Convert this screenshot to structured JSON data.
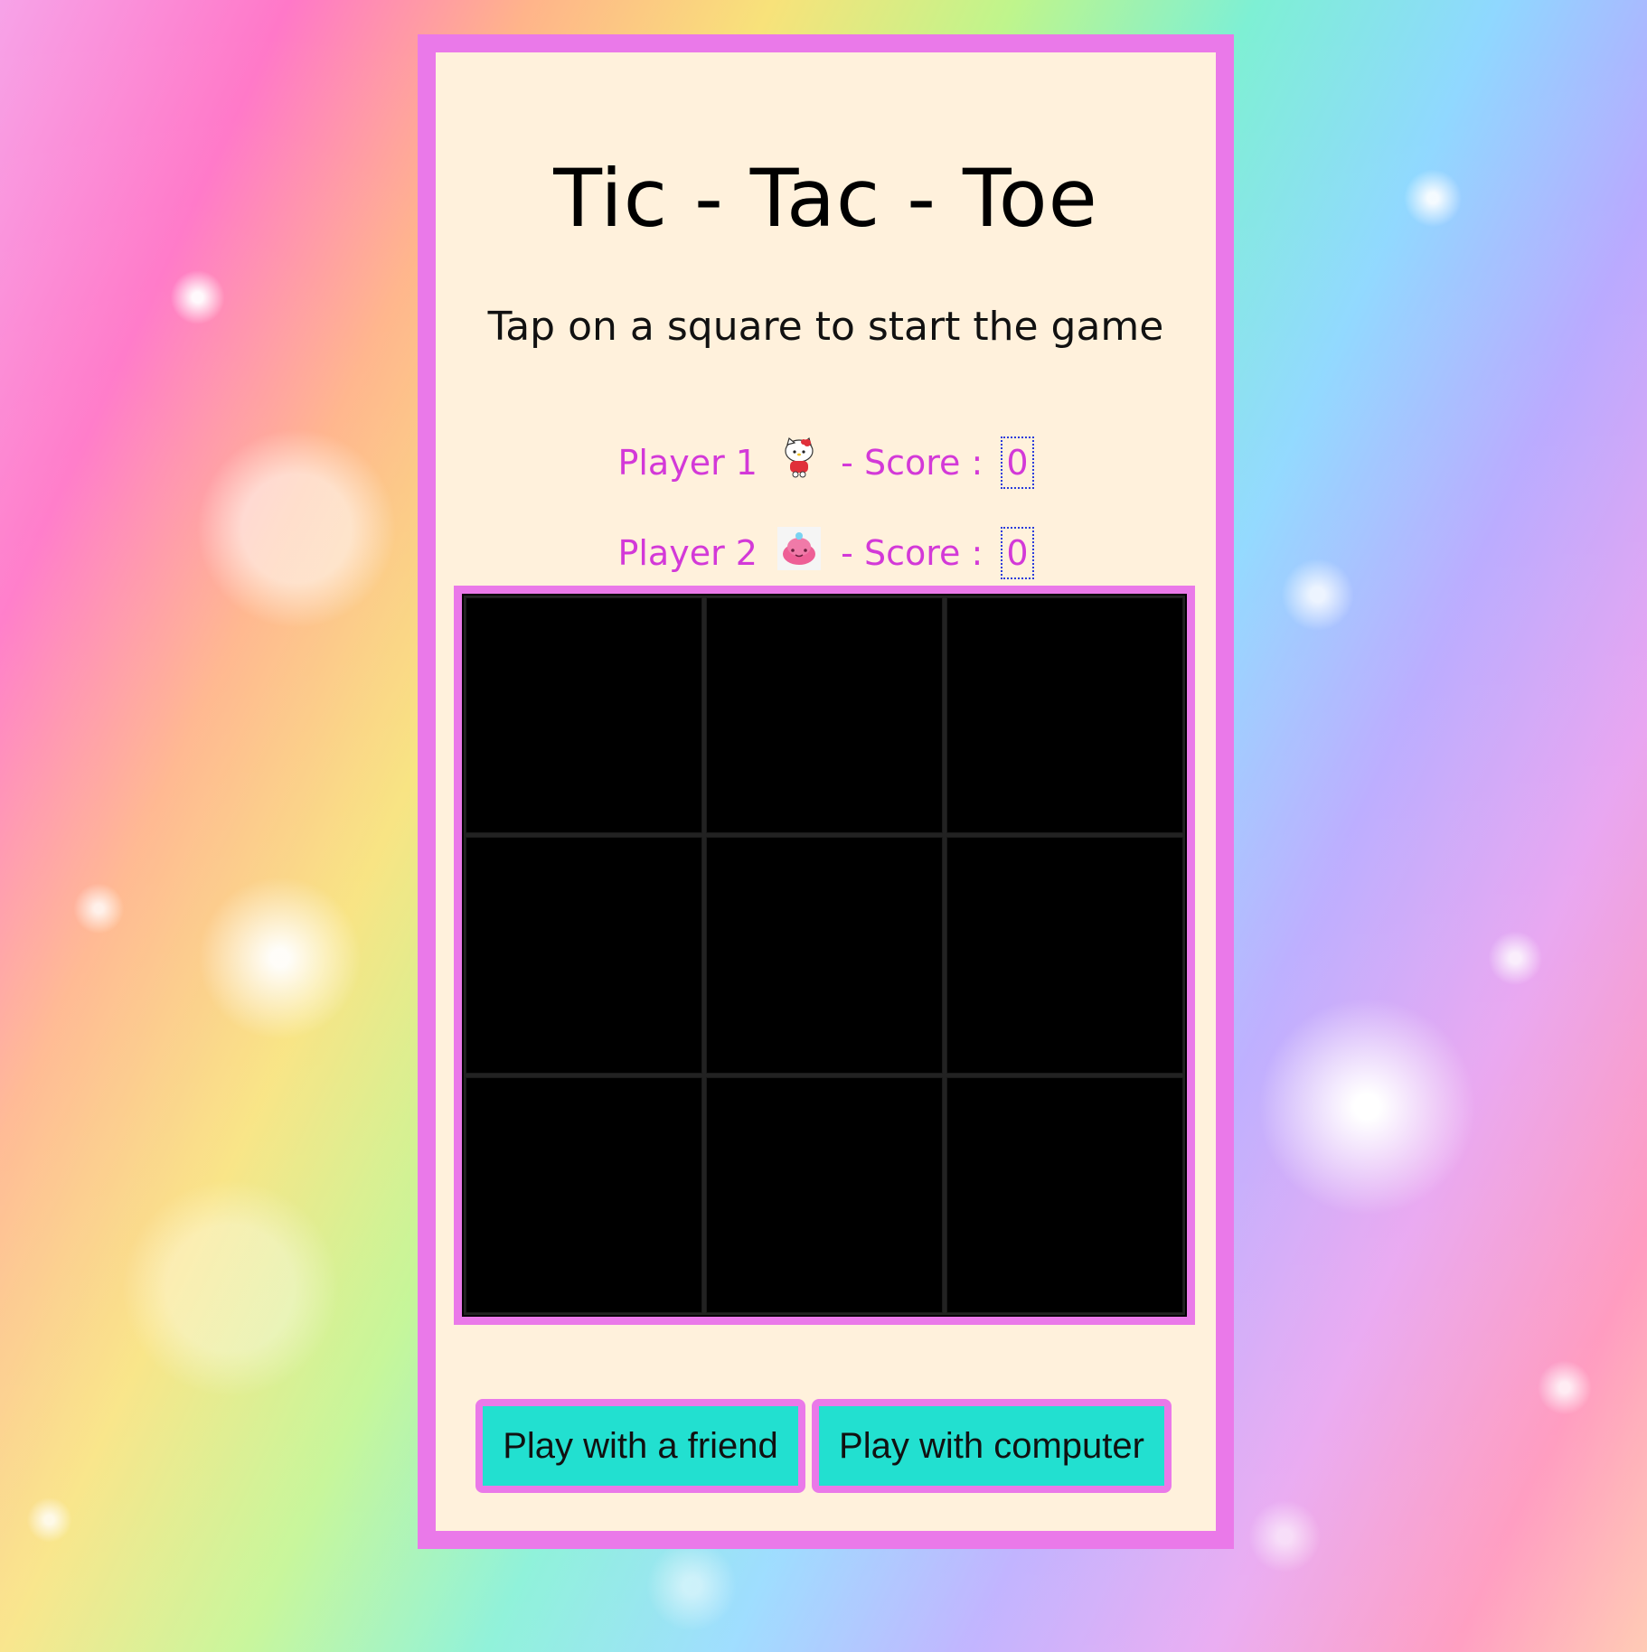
{
  "game": {
    "title": "Tic - Tac - Toe",
    "subtitle": "Tap on a square to start the game",
    "players": [
      {
        "label": "Player 1",
        "score_label": "- Score :",
        "score": "0",
        "avatar_icon": "hello-kitty-icon"
      },
      {
        "label": "Player 2",
        "score_label": "- Score :",
        "score": "0",
        "avatar_icon": "pink-jelly-icon"
      }
    ],
    "board": {
      "cells": [
        "",
        "",
        "",
        "",
        "",
        "",
        "",
        "",
        ""
      ]
    },
    "buttons": {
      "friend": "Play with a friend",
      "computer": "Play with computer"
    }
  },
  "colors": {
    "panel_bg": "#fff1dc",
    "border": "#ea79e9",
    "player_text": "#d339d8",
    "button_bg": "#22e0d0",
    "board_bg": "#000000"
  }
}
